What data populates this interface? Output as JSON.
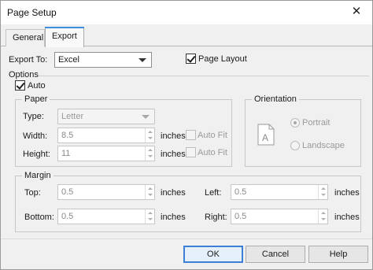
{
  "window": {
    "title": "Page Setup",
    "close_glyph": "✕"
  },
  "tabs": [
    {
      "label": "General"
    },
    {
      "label": "Export"
    }
  ],
  "export": {
    "export_to_label": "Export To:",
    "export_to_value": "Excel",
    "page_layout_label": "Page Layout",
    "page_layout_checked": true
  },
  "options": {
    "label": "Options",
    "auto_label": "Auto",
    "auto_checked": true
  },
  "paper": {
    "group_label": "Paper",
    "type_label": "Type:",
    "type_value": "Letter",
    "width_label": "Width:",
    "width_value": "8.5",
    "width_unit": "inches",
    "width_autofit": "Auto Fit",
    "height_label": "Height:",
    "height_value": "11",
    "height_unit": "inches",
    "height_autofit": "Auto Fit"
  },
  "orientation": {
    "group_label": "Orientation",
    "page_icon_letter": "A",
    "portrait_label": "Portrait",
    "landscape_label": "Landscape",
    "selected": "Portrait"
  },
  "margin": {
    "group_label": "Margin",
    "top_label": "Top:",
    "top_value": "0.5",
    "top_unit": "inches",
    "bottom_label": "Bottom:",
    "bottom_value": "0.5",
    "bottom_unit": "inches",
    "left_label": "Left:",
    "left_value": "0.5",
    "left_unit": "inches",
    "right_label": "Right:",
    "right_value": "0.5",
    "right_unit": "inches"
  },
  "buttons": {
    "ok": "OK",
    "cancel": "Cancel",
    "help": "Help"
  }
}
